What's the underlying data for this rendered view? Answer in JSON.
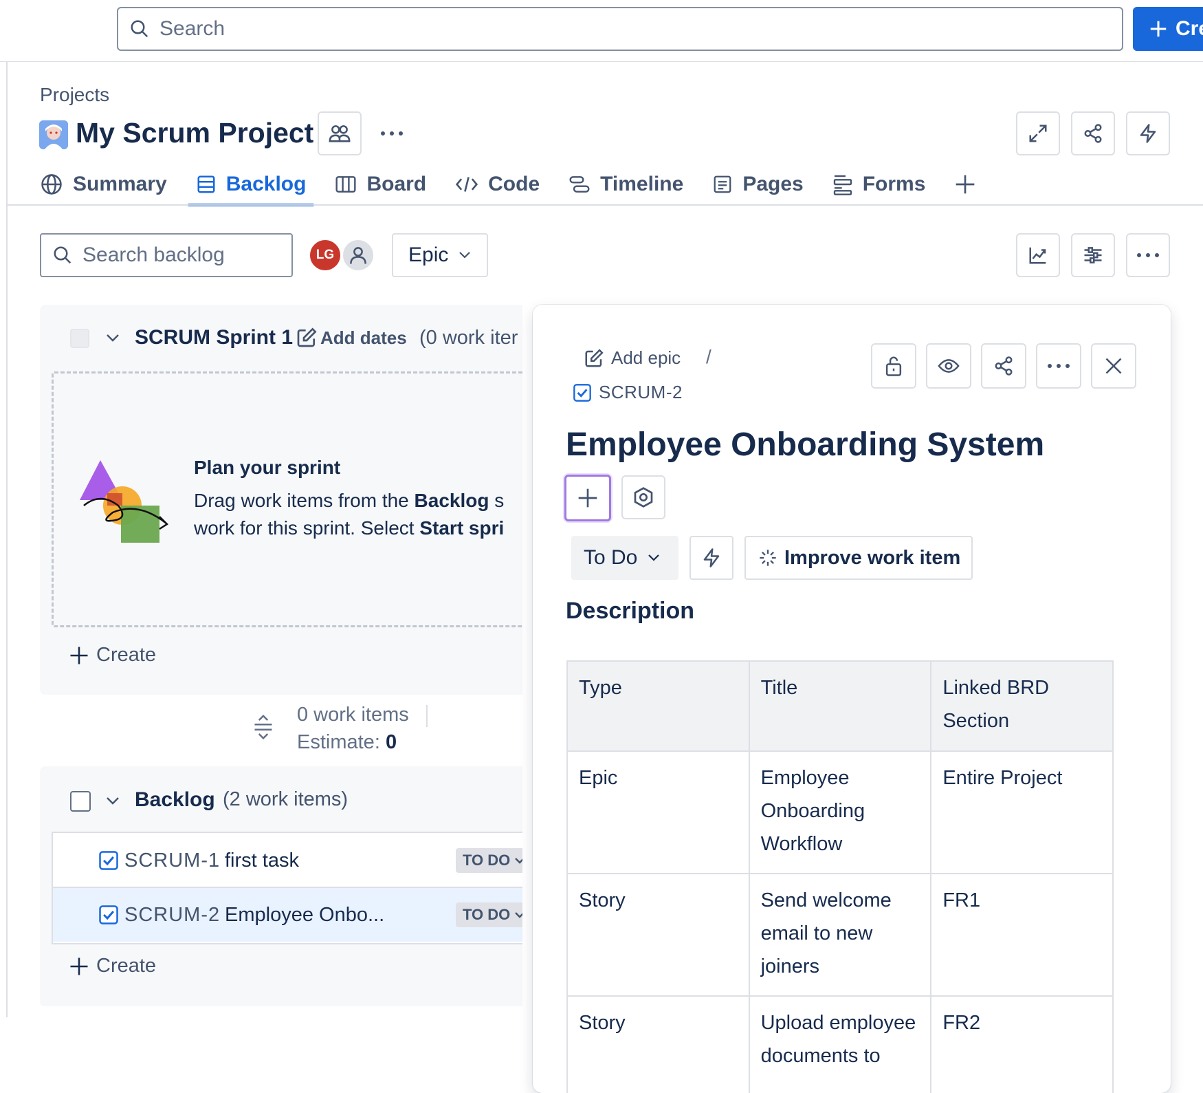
{
  "topbar": {
    "search_placeholder": "Search",
    "create_label": "Cre"
  },
  "header": {
    "breadcrumb": "Projects",
    "project_title": "My Scrum Project"
  },
  "tabs": [
    {
      "label": "Summary",
      "icon": "globe-icon"
    },
    {
      "label": "Backlog",
      "icon": "backlog-icon",
      "active": true
    },
    {
      "label": "Board",
      "icon": "board-icon"
    },
    {
      "label": "Code",
      "icon": "code-icon"
    },
    {
      "label": "Timeline",
      "icon": "timeline-icon"
    },
    {
      "label": "Pages",
      "icon": "pages-icon"
    },
    {
      "label": "Forms",
      "icon": "forms-icon"
    }
  ],
  "filters": {
    "search_placeholder": "Search backlog",
    "avatar_initials": "LG",
    "epic_label": "Epic"
  },
  "sprint": {
    "name": "SCRUM Sprint 1",
    "add_dates": "Add dates",
    "count": "(0 work iter",
    "plan_title": "Plan your sprint",
    "plan_line1_a": "Drag work items from the ",
    "plan_line1_b": "Backlog",
    "plan_line1_c": " s",
    "plan_line2_a": "work for this sprint. Select ",
    "plan_line2_b": "Start spri",
    "create_label": "Create"
  },
  "sprint_summary": {
    "work_items": "0 work items",
    "estimate_label": "Estimate: ",
    "estimate_value": "0"
  },
  "backlog": {
    "name": "Backlog",
    "count": "(2 work items)",
    "items": [
      {
        "key": "SCRUM-1",
        "title": "first task",
        "status": "TO DO"
      },
      {
        "key": "SCRUM-2",
        "title": "Employee Onbo...",
        "status": "TO DO"
      }
    ],
    "create_label": "Create"
  },
  "detail": {
    "add_epic": "Add epic",
    "separator": "/",
    "key": "SCRUM-2",
    "title": "Employee Onboarding System",
    "status": "To Do",
    "improve_label": "Improve work item",
    "description_label": "Description",
    "table": {
      "headers": [
        "Type",
        "Title",
        "Linked BRD Section"
      ],
      "rows": [
        [
          "Epic",
          "Employee Onboarding Workflow",
          "Entire Project"
        ],
        [
          "Story",
          "Send welcome email to new joiners",
          "FR1"
        ],
        [
          "Story",
          "Upload employee documents to",
          "FR2"
        ]
      ]
    }
  },
  "colors": {
    "brand_blue": "#1868db",
    "avatar_red": "#c9372c",
    "focus_purple": "#9f7ae0"
  }
}
